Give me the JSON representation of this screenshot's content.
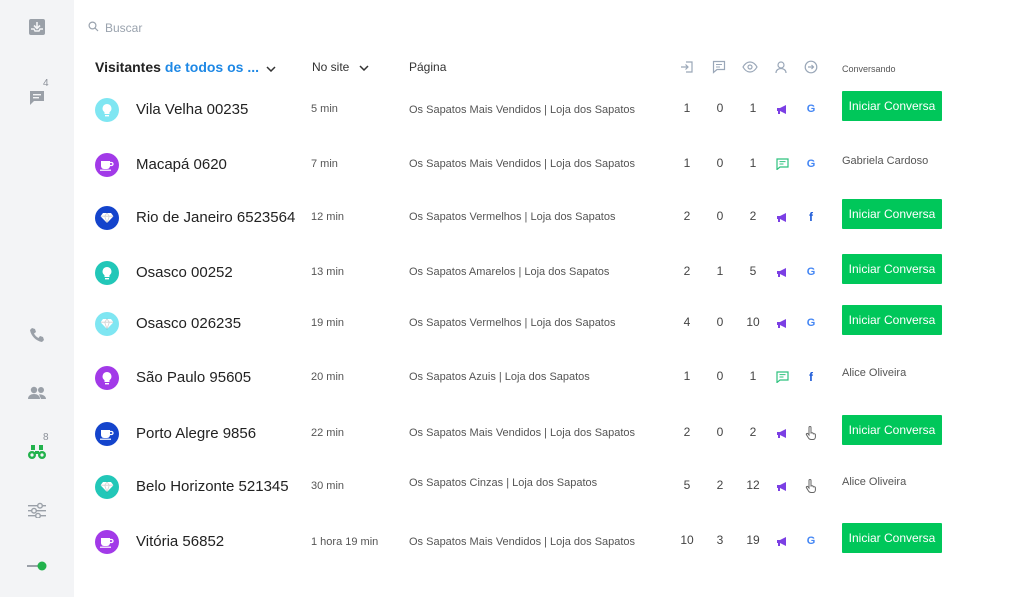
{
  "sidebar": {
    "items": [
      {
        "name": "inbox-download-icon",
        "badge": ""
      },
      {
        "name": "chat-icon",
        "badge": "4"
      },
      {
        "name": "phone-icon",
        "badge": ""
      },
      {
        "name": "contacts-icon",
        "badge": ""
      },
      {
        "name": "binoculars-icon",
        "badge": "8"
      },
      {
        "name": "sliders-icon",
        "badge": ""
      },
      {
        "name": "status-toggle-icon",
        "badge": ""
      }
    ]
  },
  "search": {
    "placeholder": "Buscar",
    "value": ""
  },
  "header": {
    "title_prefix": "Visitantes",
    "scope": "de todos os ...",
    "time_filter": "No site",
    "page_col": "Página",
    "conv_col": "Conversando",
    "icon_cols": [
      "entries-icon",
      "messages-icon",
      "views-icon",
      "agent-icon",
      "referrer-icon"
    ]
  },
  "colors": {
    "accent_blue": "#1e88e5",
    "cta_green": "#00c75a",
    "campaign_purple": "#7b3fe4",
    "chat_green": "#2ec27e",
    "avatar_purple": "#a23ae8",
    "avatar_navy": "#1444cc",
    "avatar_teal": "#22c7b8",
    "avatar_lightcyan": "#7fe6f2"
  },
  "cta_label": "Iniciar Conversa",
  "visitors": [
    {
      "name": "Vila Velha 00235",
      "time": "5 min",
      "page": "Os Sapatos Mais Vendidos | Loja dos Sapatos",
      "c1": "1",
      "c2": "0",
      "c3": "1",
      "source": "campaign",
      "referrer": "google",
      "agent": "",
      "avatar_icon": "lightbulb-icon",
      "avatar_color": "#7fe6f2"
    },
    {
      "name": "Macapá 0620",
      "time": "7 min",
      "page": "Os Sapatos Mais Vendidos | Loja dos Sapatos",
      "c1": "1",
      "c2": "0",
      "c3": "1",
      "source": "chat",
      "referrer": "google",
      "agent": "Gabriela Cardoso",
      "avatar_icon": "cup-icon",
      "avatar_color": "#a23ae8"
    },
    {
      "name": "Rio de Janeiro 6523564",
      "time": "12 min",
      "page": "Os Sapatos Vermelhos | Loja dos Sapatos",
      "c1": "2",
      "c2": "0",
      "c3": "2",
      "source": "campaign",
      "referrer": "facebook",
      "agent": "",
      "avatar_icon": "diamond-icon",
      "avatar_color": "#1444cc"
    },
    {
      "name": "Osasco 00252",
      "time": "13 min",
      "page": "Os Sapatos Amarelos | Loja dos Sapatos",
      "c1": "2",
      "c2": "1",
      "c3": "5",
      "source": "campaign",
      "referrer": "google",
      "agent": "",
      "avatar_icon": "lightbulb-icon",
      "avatar_color": "#22c7b8"
    },
    {
      "name": "Osasco 026235",
      "time": "19 min",
      "page": "Os Sapatos Vermelhos | Loja dos Sapatos",
      "c1": "4",
      "c2": "0",
      "c3": "10",
      "source": "campaign",
      "referrer": "google",
      "agent": "",
      "avatar_icon": "diamond-icon",
      "avatar_color": "#7fe6f2"
    },
    {
      "name": "São Paulo 95605",
      "time": "20 min",
      "page": "Os Sapatos Azuis | Loja dos Sapatos",
      "c1": "1",
      "c2": "0",
      "c3": "1",
      "source": "chat",
      "referrer": "facebook",
      "agent": "Alice Oliveira",
      "avatar_icon": "lightbulb-icon",
      "avatar_color": "#a23ae8"
    },
    {
      "name": "Porto Alegre 9856",
      "time": "22 min",
      "page": "Os Sapatos Mais Vendidos | Loja dos Sapatos",
      "c1": "2",
      "c2": "0",
      "c3": "2",
      "source": "campaign",
      "referrer": "direct",
      "agent": "",
      "avatar_icon": "cup-icon",
      "avatar_color": "#1444cc"
    },
    {
      "name": "Belo Horizonte 521345",
      "time": "30 min",
      "page": "Os Sapatos Cinzas | Loja dos Sapatos",
      "c1": "5",
      "c2": "2",
      "c3": "12",
      "source": "campaign",
      "referrer": "direct",
      "agent": "Alice Oliveira",
      "avatar_icon": "diamond-icon",
      "avatar_color": "#22c7b8"
    },
    {
      "name": "Vitória 56852",
      "time": "1 hora 19 min",
      "page": "Os Sapatos Mais Vendidos | Loja dos Sapatos",
      "c1": "10",
      "c2": "3",
      "c3": "19",
      "source": "campaign",
      "referrer": "google",
      "agent": "",
      "avatar_icon": "cup-icon",
      "avatar_color": "#a23ae8"
    }
  ]
}
